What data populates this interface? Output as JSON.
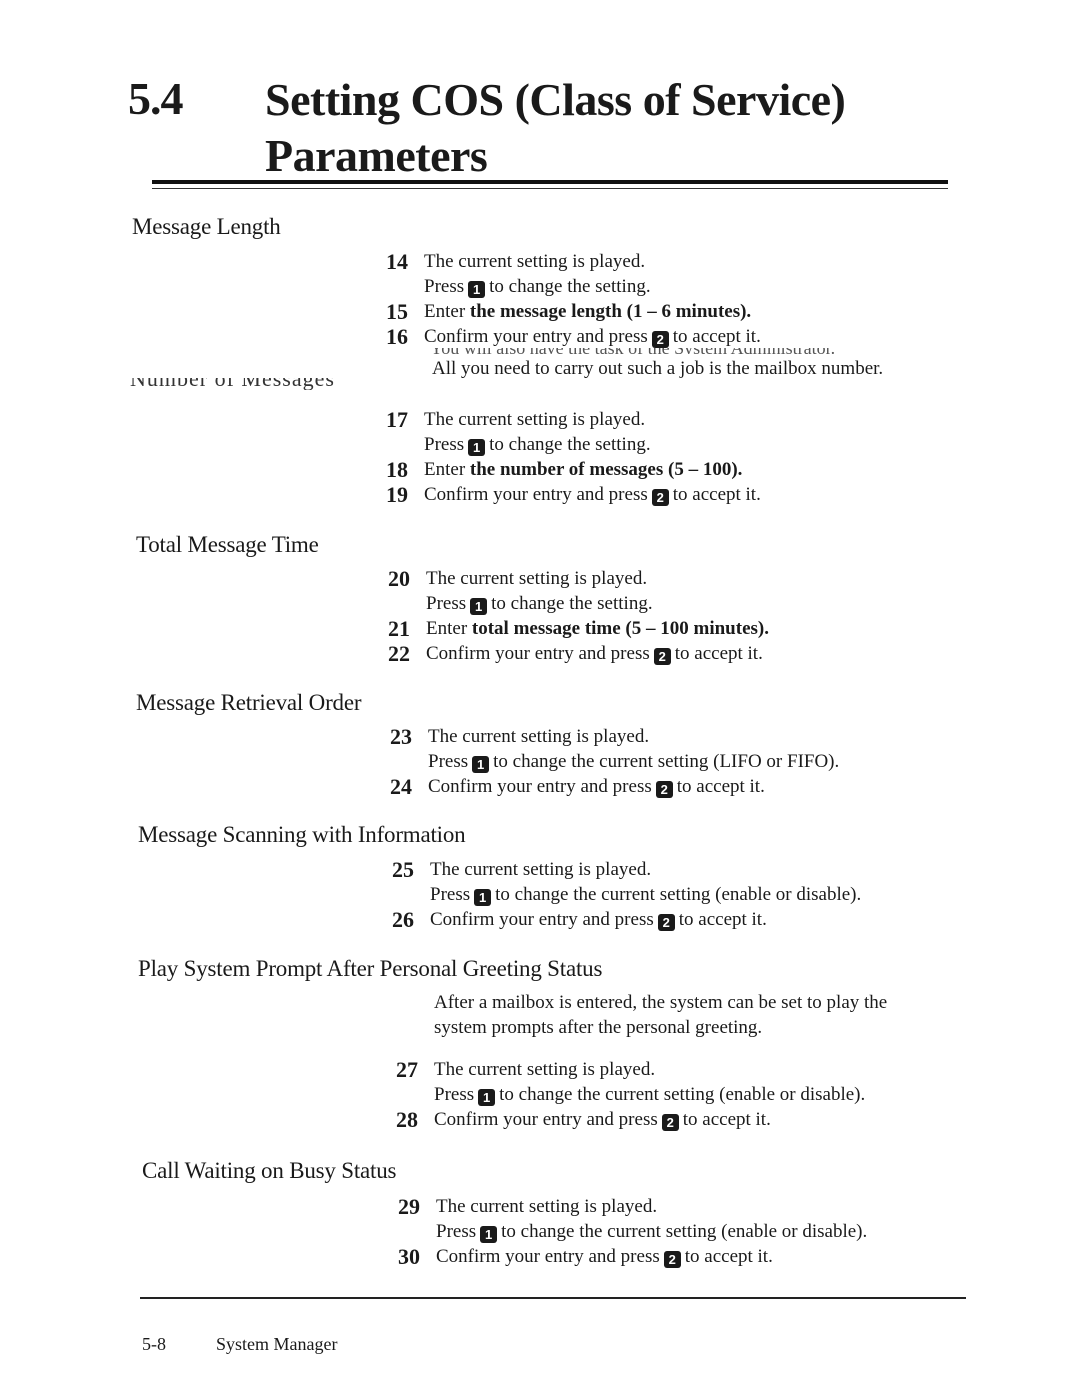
{
  "section": {
    "number": "5.4",
    "title_line1": "Setting COS (Class of Service)",
    "title_line2": "Parameters"
  },
  "common": {
    "played": "The current setting is played.",
    "press": "Press",
    "key1": "1",
    "key2": "2",
    "change_setting": "to change the setting.",
    "confirm": "Confirm your entry and press",
    "accept": "to accept it.",
    "enter": "Enter"
  },
  "blocks": {
    "message_length": {
      "heading": "Message Length",
      "steps": [
        "14",
        "15",
        "16"
      ],
      "enter_bold": "the message length (1 – 6 minutes).",
      "overlap_text": "You will also have the task of the System Administrator.",
      "note": "All you need to carry out such a job is the mailbox number."
    },
    "number_of_messages": {
      "heading": "Number of Messages",
      "steps": [
        "17",
        "18",
        "19"
      ],
      "enter_bold": "the number of messages (5 – 100)."
    },
    "total_message_time": {
      "heading": "Total Message Time",
      "steps": [
        "20",
        "21",
        "22"
      ],
      "enter_bold": "total message time (5 – 100 minutes)."
    },
    "retrieval_order": {
      "heading": "Message Retrieval Order",
      "steps": [
        "23",
        "24"
      ],
      "change_text": "to change the current setting (LIFO or FIFO)."
    },
    "scanning": {
      "heading": "Message Scanning with Information",
      "steps": [
        "25",
        "26"
      ],
      "change_text": "to change the current setting (enable or disable)."
    },
    "system_prompt": {
      "heading": "Play System Prompt After Personal Greeting Status",
      "desc_line1": "After a mailbox is entered, the system can be set to play the",
      "desc_line2": "system prompts after the personal greeting.",
      "steps": [
        "27",
        "28"
      ],
      "change_text": "to change the current setting (enable or disable)."
    },
    "call_waiting": {
      "heading": "Call Waiting on Busy Status",
      "steps": [
        "29",
        "30"
      ],
      "change_text": "to change the current setting (enable or disable)."
    }
  },
  "footer": {
    "page": "5-8",
    "label": "System Manager"
  }
}
